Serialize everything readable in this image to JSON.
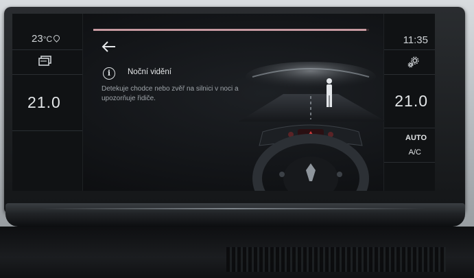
{
  "climate": {
    "outside_temp": "23",
    "outside_unit": "°C",
    "driver_temp": "21.0",
    "passenger_temp": "21.0",
    "auto_label": "AUTO",
    "ac_label": "A/C"
  },
  "status": {
    "time": "11:35"
  },
  "page": {
    "progress_fraction": 0.99,
    "feature_title": "Noční vidění",
    "feature_description": "Detekuje chodce nebo zvěř na silnici v noci a upozorňuje řidiče."
  },
  "icons": {
    "back": "arrow-left-icon",
    "info": "info-icon",
    "recirculation": "recirculation-icon",
    "settings": "gear-icon",
    "location": "location-pin-icon"
  },
  "colors": {
    "screen_bg": "#121417",
    "progress": "#c89aa1",
    "text_primary": "#e6e8ea",
    "text_secondary": "#9fa5aa",
    "warning_red": "#d23a3a"
  }
}
